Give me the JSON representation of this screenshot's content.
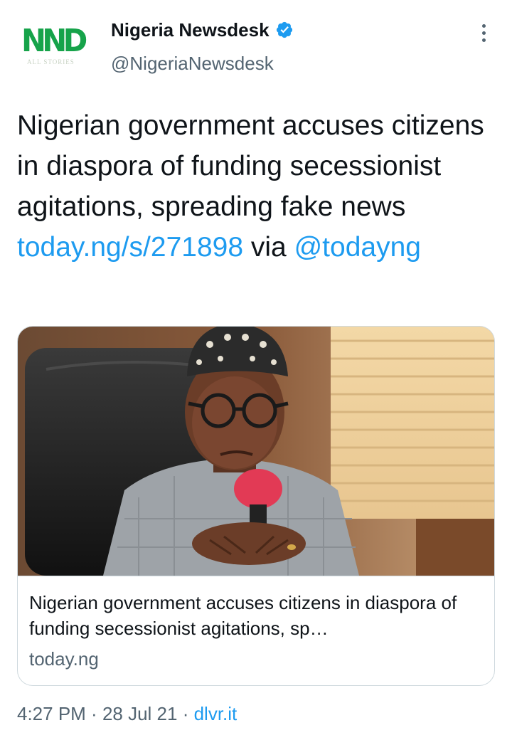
{
  "author": {
    "avatar_logo_text": "NND",
    "avatar_sub_text": "ALL STORIES",
    "display_name": "Nigeria Newsdesk",
    "handle": "@NigeriaNewsdesk",
    "verified_icon": "verified-badge-icon"
  },
  "tweet": {
    "text_before_link": "Nigerian government accuses citizens in diaspora of funding secessionist agitations, spreading fake news ",
    "link": "today.ng/s/271898",
    "text_via": " via ",
    "mention": "@todayng"
  },
  "card": {
    "image_icon": "photo-man-with-microphone",
    "title": "Nigerian government accuses citizens in diaspora of funding secessionist agitations, sp…",
    "domain": "today.ng"
  },
  "meta": {
    "time": "4:27 PM",
    "separator": " · ",
    "date": "28 Jul 21",
    "source": "dlvr.it"
  },
  "colors": {
    "link": "#1d9bf0",
    "secondary_text": "#536471",
    "logo_green": "#16a34a",
    "border": "#cfd9de"
  }
}
